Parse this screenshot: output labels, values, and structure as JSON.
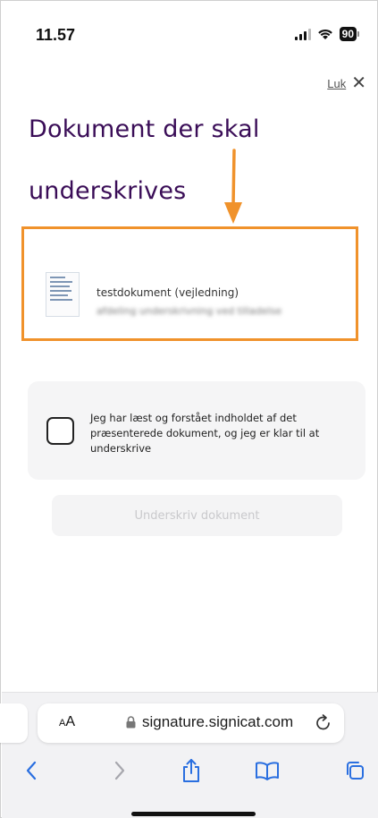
{
  "status_bar": {
    "time": "11.57",
    "battery": "90"
  },
  "close": {
    "label": "Luk",
    "icon": "close-icon"
  },
  "heading": {
    "line1": "Dokument der skal",
    "line2": "underskrives"
  },
  "document": {
    "title": "testdokument (vejledning)",
    "subtitle": "afdeling underskrivning ved tilladelse",
    "icon": "document-thumbnail"
  },
  "consent": {
    "text": "Jeg har læst og forstået indholdet af det præsenterede dokument, og jeg er klar til at underskrive",
    "checked": false
  },
  "sign_button": {
    "label": "Underskriv dokument",
    "enabled": false
  },
  "browser": {
    "aa_label_small": "A",
    "aa_label_large": "A",
    "url": "signature.signicat.com",
    "toolbar": [
      "back-icon",
      "forward-icon",
      "share-icon",
      "bookmarks-icon",
      "tabs-icon"
    ]
  },
  "colors": {
    "accent_heading": "#3a0d57",
    "highlight": "#f0922b"
  }
}
